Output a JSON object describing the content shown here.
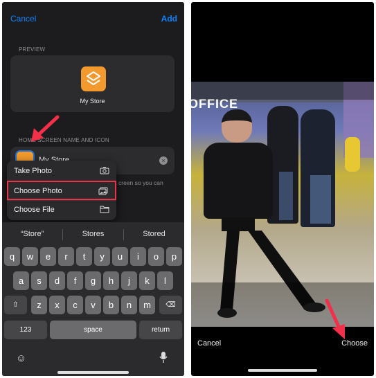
{
  "left": {
    "cancel": "Cancel",
    "add": "Add",
    "preview_label": "PREVIEW",
    "preview_name": "My Store",
    "section_label": "HOME SCREEN NAME AND ICON",
    "name_value": "My Store",
    "hint_text": "creen so you can",
    "menu": [
      {
        "label": "Take Photo",
        "icon": "camera-icon"
      },
      {
        "label": "Choose Photo",
        "icon": "photo-icon",
        "highlighted": true
      },
      {
        "label": "Choose File",
        "icon": "folder-icon"
      }
    ],
    "suggestions": [
      "“Store”",
      "Stores",
      "Stored"
    ],
    "rows": [
      [
        "q",
        "w",
        "e",
        "r",
        "t",
        "y",
        "u",
        "i",
        "o",
        "p"
      ],
      [
        "a",
        "s",
        "d",
        "f",
        "g",
        "h",
        "j",
        "k",
        "l"
      ],
      [
        "z",
        "x",
        "c",
        "v",
        "b",
        "n",
        "m"
      ]
    ],
    "key_123": "123",
    "key_space": "space",
    "key_return": "return",
    "accent": "#0a84ff",
    "highlight": "#e8354a"
  },
  "right": {
    "cancel": "Cancel",
    "choose": "Choose",
    "sign_text": "OFFICE"
  }
}
